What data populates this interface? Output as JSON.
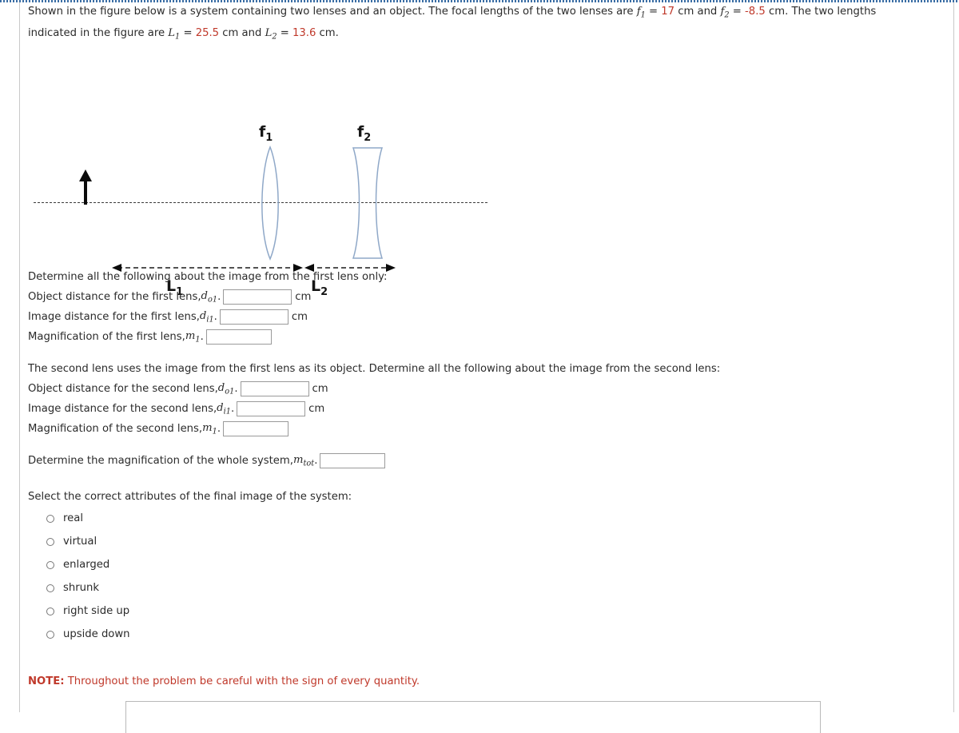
{
  "intro": {
    "part1": "Shown in the figure below is a system containing two lenses and an object. The focal lengths of the two lenses are ",
    "f1_symbol": "f",
    "f1_sub": "1",
    "eq1": " = ",
    "f1_value": "17",
    "unit1": " cm and ",
    "f2_symbol": "f",
    "f2_sub": "2",
    "eq2": " = ",
    "f2_value": "-8.5",
    "part2": " cm. The two lengths indicated in the figure are ",
    "L1_symbol": "L",
    "L1_sub": "1",
    "eq3": " = ",
    "L1_value": "25.5",
    "unit2": " cm and ",
    "L2_symbol": "L",
    "L2_sub": "2",
    "eq4": " = ",
    "L2_value": "13.6",
    "unit3": " cm."
  },
  "figure": {
    "lens1_label": "f",
    "lens1_sub": "1",
    "lens2_label": "f",
    "lens2_sub": "2",
    "dim1_label": "L",
    "dim1_sub": "1",
    "dim2_label": "L",
    "dim2_sub": "2",
    "lens1_type": "converging-biconvex-lens",
    "lens2_type": "diverging-biconcave-lens",
    "object_type": "upright-object-arrow",
    "axis_type": "dashed-optical-axis",
    "stroke_color": "#8fa8c8",
    "axis_color": "#3a3a3a"
  },
  "section1": {
    "heading": "Determine all the following about the image from the first lens only:",
    "rows": [
      {
        "prefix": "Object distance for the first lens, ",
        "var": "d",
        "sub": "o1",
        "period": ".",
        "value": "",
        "unit": "cm"
      },
      {
        "prefix": "Image distance for the first lens, ",
        "var": "d",
        "sub": "i1",
        "period": ".",
        "value": "",
        "unit": "cm"
      },
      {
        "prefix": "Magnification of the first lens, ",
        "var": "m",
        "sub": "1",
        "period": ".",
        "value": "",
        "unit": ""
      }
    ]
  },
  "section2": {
    "heading": "The second lens uses the image from the first lens as its object. Determine all the following about the image from the second lens:",
    "rows": [
      {
        "prefix": "Object distance for the second lens, ",
        "var": "d",
        "sub": "o1",
        "period": ".",
        "value": "",
        "unit": "cm"
      },
      {
        "prefix": "Image distance for the second lens, ",
        "var": "d",
        "sub": "i1",
        "period": ".",
        "value": "",
        "unit": "cm"
      },
      {
        "prefix": "Magnification of the second lens, ",
        "var": "m",
        "sub": "1",
        "period": ".",
        "value": "",
        "unit": ""
      }
    ]
  },
  "section3": {
    "prefix": "Determine the magnification of the whole system, ",
    "var": "m",
    "sub": "tot",
    "period": ".",
    "value": ""
  },
  "section4": {
    "heading": "Select the correct attributes of the final image of the system:",
    "options": [
      {
        "label": "real",
        "selected": false
      },
      {
        "label": "virtual",
        "selected": false
      },
      {
        "label": "enlarged",
        "selected": false
      },
      {
        "label": "shrunk",
        "selected": false
      },
      {
        "label": "right side up",
        "selected": false
      },
      {
        "label": "upside down",
        "selected": false
      }
    ]
  },
  "note": {
    "bold": "NOTE:",
    "text": " Throughout the problem be careful with the sign of every quantity.",
    "color": "#c0392b"
  }
}
